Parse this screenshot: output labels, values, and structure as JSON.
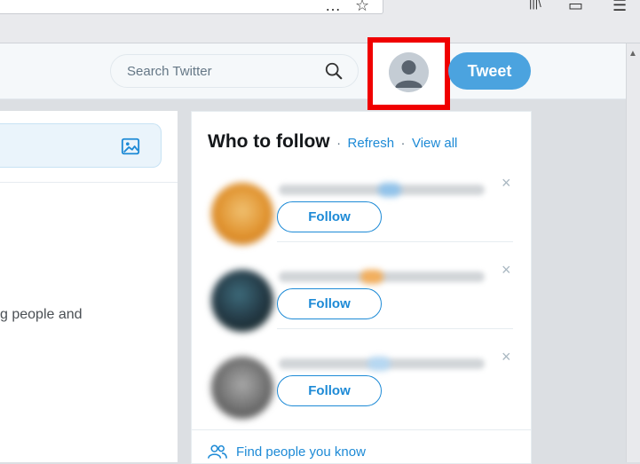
{
  "browser": {
    "toolbar_glyphs": [
      "…",
      "☆",
      "|||\\",
      "▭",
      "☰"
    ]
  },
  "nav": {
    "search": {
      "placeholder": "Search Twitter",
      "icon": "search-icon"
    },
    "profile": {
      "icon": "avatar-icon",
      "highlight_color": "#f00000"
    },
    "tweet_label": "Tweet",
    "accent": "#4ba3df"
  },
  "left": {
    "compose_icon": "image-icon",
    "body_text": "g people and"
  },
  "who_to_follow": {
    "title": "Who to follow",
    "separator": "·",
    "refresh_label": "Refresh",
    "view_all_label": "View all",
    "suggestions": [
      {
        "follow_label": "Follow",
        "dismiss": "×",
        "avatar_color": "#e0922e"
      },
      {
        "follow_label": "Follow",
        "dismiss": "×",
        "avatar_color": "#243a46"
      },
      {
        "follow_label": "Follow",
        "dismiss": "×",
        "avatar_color": "#6f6f6f"
      }
    ],
    "find_people_label": "Find people you know",
    "find_people_icon": "people-icon",
    "link_color": "#1d8ad6"
  }
}
